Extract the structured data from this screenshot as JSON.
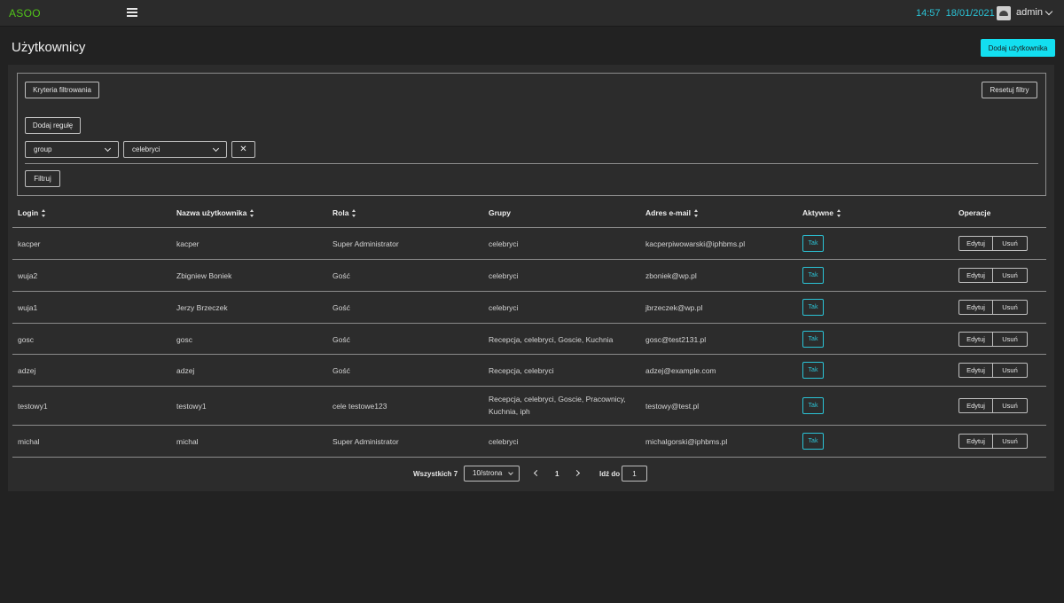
{
  "topbar": {
    "logo": "ASOO",
    "time": "14:57",
    "date": "18/01/2021",
    "user": "admin"
  },
  "header": {
    "title": "Użytkownicy",
    "add_user_label": "Dodaj użytkownika"
  },
  "filters": {
    "criteria_label": "Kryteria filtrowania",
    "reset_label": "Resetuj filtry",
    "add_rule_label": "Dodaj regułę",
    "rule": {
      "field": "group",
      "value": "celebryci"
    },
    "remove_symbol": "✕",
    "filter_label": "Filtruj"
  },
  "table": {
    "columns": {
      "login": "Login",
      "username": "Nazwa użytkownika",
      "role": "Rola",
      "groups": "Grupy",
      "email": "Adres e-mail",
      "active": "Aktywne",
      "operations": "Operacje"
    },
    "edit_label": "Edytuj",
    "delete_label": "Usuń",
    "rows": [
      {
        "login": "kacper",
        "username": "kacper",
        "role": "Super Administrator",
        "groups": "celebryci",
        "email": "kacperpiwowarski@iphbms.pl",
        "active": "Tak"
      },
      {
        "login": "wuja2",
        "username": "Zbigniew Boniek",
        "role": "Gość",
        "groups": "celebryci",
        "email": "zboniek@wp.pl",
        "active": "Tak"
      },
      {
        "login": "wuja1",
        "username": "Jerzy Brzeczek",
        "role": "Gość",
        "groups": "celebryci",
        "email": "jbrzeczek@wp.pl",
        "active": "Tak"
      },
      {
        "login": "gosc",
        "username": "gosc",
        "role": "Gość",
        "groups": "Recepcja, celebryci, Goscie, Kuchnia",
        "email": "gosc@test2131.pl",
        "active": "Tak"
      },
      {
        "login": "adzej",
        "username": "adzej",
        "role": "Gość",
        "groups": "Recepcja, celebryci",
        "email": "adzej@example.com",
        "active": "Tak"
      },
      {
        "login": "testowy1",
        "username": "testowy1",
        "role": "cele testowe123",
        "groups": "Recepcja, celebryci, Goscie, Pracownicy, Kuchnia, iph",
        "email": "testowy@test.pl",
        "active": "Tak"
      },
      {
        "login": "michal",
        "username": "michal",
        "role": "Super Administrator",
        "groups": "celebryci",
        "email": "michalgorski@iphbms.pl",
        "active": "Tak"
      }
    ]
  },
  "pagination": {
    "total": "Wszystkich 7",
    "page_size": "10/strona",
    "current_page": "1",
    "goto_label": "Idź do",
    "goto_value": "1"
  }
}
